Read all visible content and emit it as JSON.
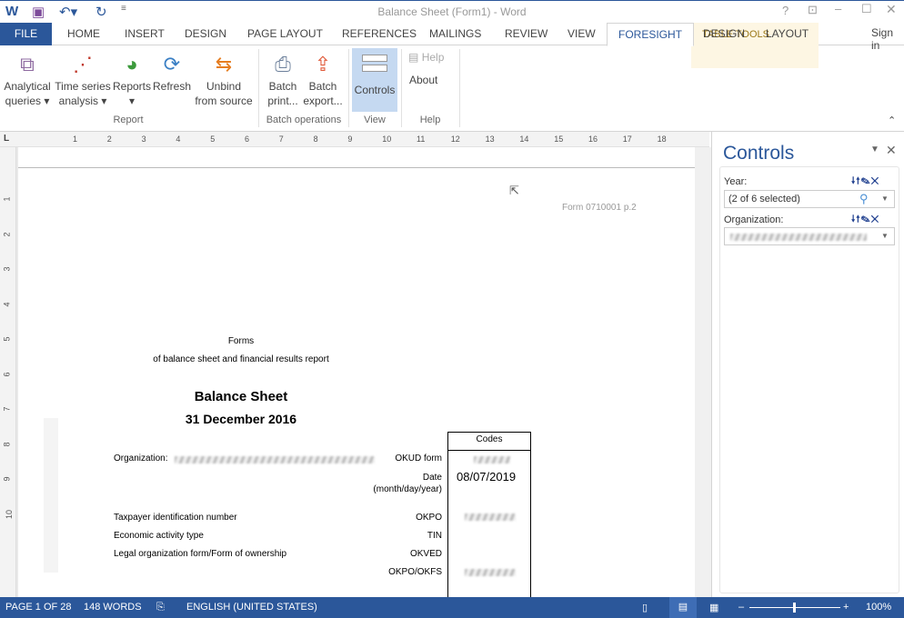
{
  "window": {
    "title": "Balance Sheet (Form1) - Word",
    "sign_in": "Sign in",
    "table_tools": "TABLE TOOLS"
  },
  "tabs": [
    "FILE",
    "HOME",
    "INSERT",
    "DESIGN",
    "PAGE LAYOUT",
    "REFERENCES",
    "MAILINGS",
    "REVIEW",
    "VIEW",
    "FORESIGHT",
    "DESIGN",
    "LAYOUT"
  ],
  "ribbon": {
    "report": {
      "analytical": [
        "Analytical",
        "queries"
      ],
      "timeseries": [
        "Time series",
        "analysis"
      ],
      "reports": "Reports",
      "refresh": "Refresh",
      "unbind": [
        "Unbind",
        "from source"
      ],
      "group": "Report"
    },
    "batch": {
      "print": [
        "Batch",
        "print..."
      ],
      "export": [
        "Batch",
        "export..."
      ],
      "group": "Batch operations"
    },
    "view": {
      "controls": "Controls",
      "group": "View"
    },
    "help": {
      "help": "Help",
      "about": "About",
      "group": "Help"
    }
  },
  "ruler": [
    "1",
    "2",
    "3",
    "4",
    "5",
    "6",
    "7",
    "8",
    "9",
    "10",
    "11",
    "12",
    "13",
    "14",
    "15",
    "16",
    "17",
    "18"
  ],
  "vruler": [
    "1",
    "2",
    "3",
    "4",
    "5",
    "6",
    "7",
    "8",
    "9",
    "10"
  ],
  "document": {
    "form_ref": "Form 0710001 p.2",
    "forms": "Forms",
    "subtitle": "of balance sheet and financial results report",
    "title": "Balance Sheet",
    "date": "31 December 2016",
    "codes": "Codes",
    "org_label": "Organization:",
    "left_rows": [
      "Taxpayer identification number",
      "Economic activity type",
      "Legal organization form/Form of ownership"
    ],
    "code_labels": [
      "OKUD form",
      "Date (month/day/year)",
      "OKPO",
      "TIN",
      "OKVED",
      "OKPO/OKFS"
    ],
    "date_value": "08/07/2019"
  },
  "pane": {
    "title": "Controls",
    "year_label": "Year:",
    "year_value": "(2 of 6 selected)",
    "org_label": "Organization:"
  },
  "status": {
    "page": "PAGE 1 OF 28",
    "words": "148 WORDS",
    "language": "ENGLISH (UNITED STATES)",
    "zoom": "100%"
  }
}
